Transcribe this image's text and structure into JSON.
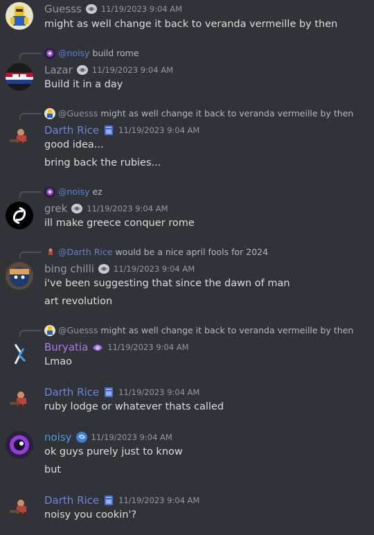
{
  "colors": {
    "background": "#313338",
    "username_default": "#949ba4",
    "username_darth": "#6f86dc",
    "username_buryatia": "#a97ee6",
    "username_noisy": "#4c9be8",
    "reply_mention_noisy": "#5c8be8",
    "reply_mention_guesss": "#9aa0a8",
    "reply_mention_darth": "#6f86dc"
  },
  "messages": [
    {
      "user": "Guesss",
      "badge": "role-icon",
      "time": "11/19/2023 9:04 AM",
      "lines": [
        "might as well change it back to veranda  vermeille by then"
      ]
    },
    {
      "reply": {
        "who": "@noisy",
        "text": "build rome"
      },
      "user": "Lazar",
      "badge": "role-icon",
      "time": "11/19/2023 9:04 AM",
      "lines": [
        "Build it in a day"
      ]
    },
    {
      "reply": {
        "who": "@Guesss",
        "text": "might as well change it back to veranda vermeille by then"
      },
      "user": "Darth Rice",
      "badge": "book-icon",
      "time": "11/19/2023 9:04 AM",
      "lines": [
        "good idea...",
        "bring back the rubies..."
      ]
    },
    {
      "reply": {
        "who": "@noisy",
        "text": "ez"
      },
      "user": "grek",
      "badge": "role-icon",
      "time": "11/19/2023 9:04 AM",
      "lines": [
        "ill make greece conquer rome"
      ]
    },
    {
      "reply": {
        "who": "@Darth Rice",
        "text": "would be a nice april fools for 2024"
      },
      "user": "bing chilli",
      "badge": "role-icon",
      "time": "11/19/2023 9:04 AM",
      "lines": [
        "i've been suggesting that since the dawn of man",
        "art revolution"
      ]
    },
    {
      "reply": {
        "who": "@Guesss",
        "text": "might as well change it back to veranda vermeille by then"
      },
      "user": "Buryatia",
      "badge": "gem-icon",
      "time": "11/19/2023 9:04 AM",
      "lines": [
        "Lmao"
      ]
    },
    {
      "user": "Darth Rice",
      "badge": "book-icon",
      "time": "11/19/2023 9:04 AM",
      "lines": [
        "ruby lodge or whatever thats called"
      ]
    },
    {
      "user": "noisy",
      "badge": "swirl-icon",
      "time": "11/19/2023 9:04 AM",
      "lines": [
        "ok guys purely just to know",
        "but"
      ]
    },
    {
      "user": "Darth Rice",
      "badge": "book-icon",
      "time": "11/19/2023 9:04 AM",
      "lines": [
        "noisy you cookin'?"
      ]
    }
  ]
}
